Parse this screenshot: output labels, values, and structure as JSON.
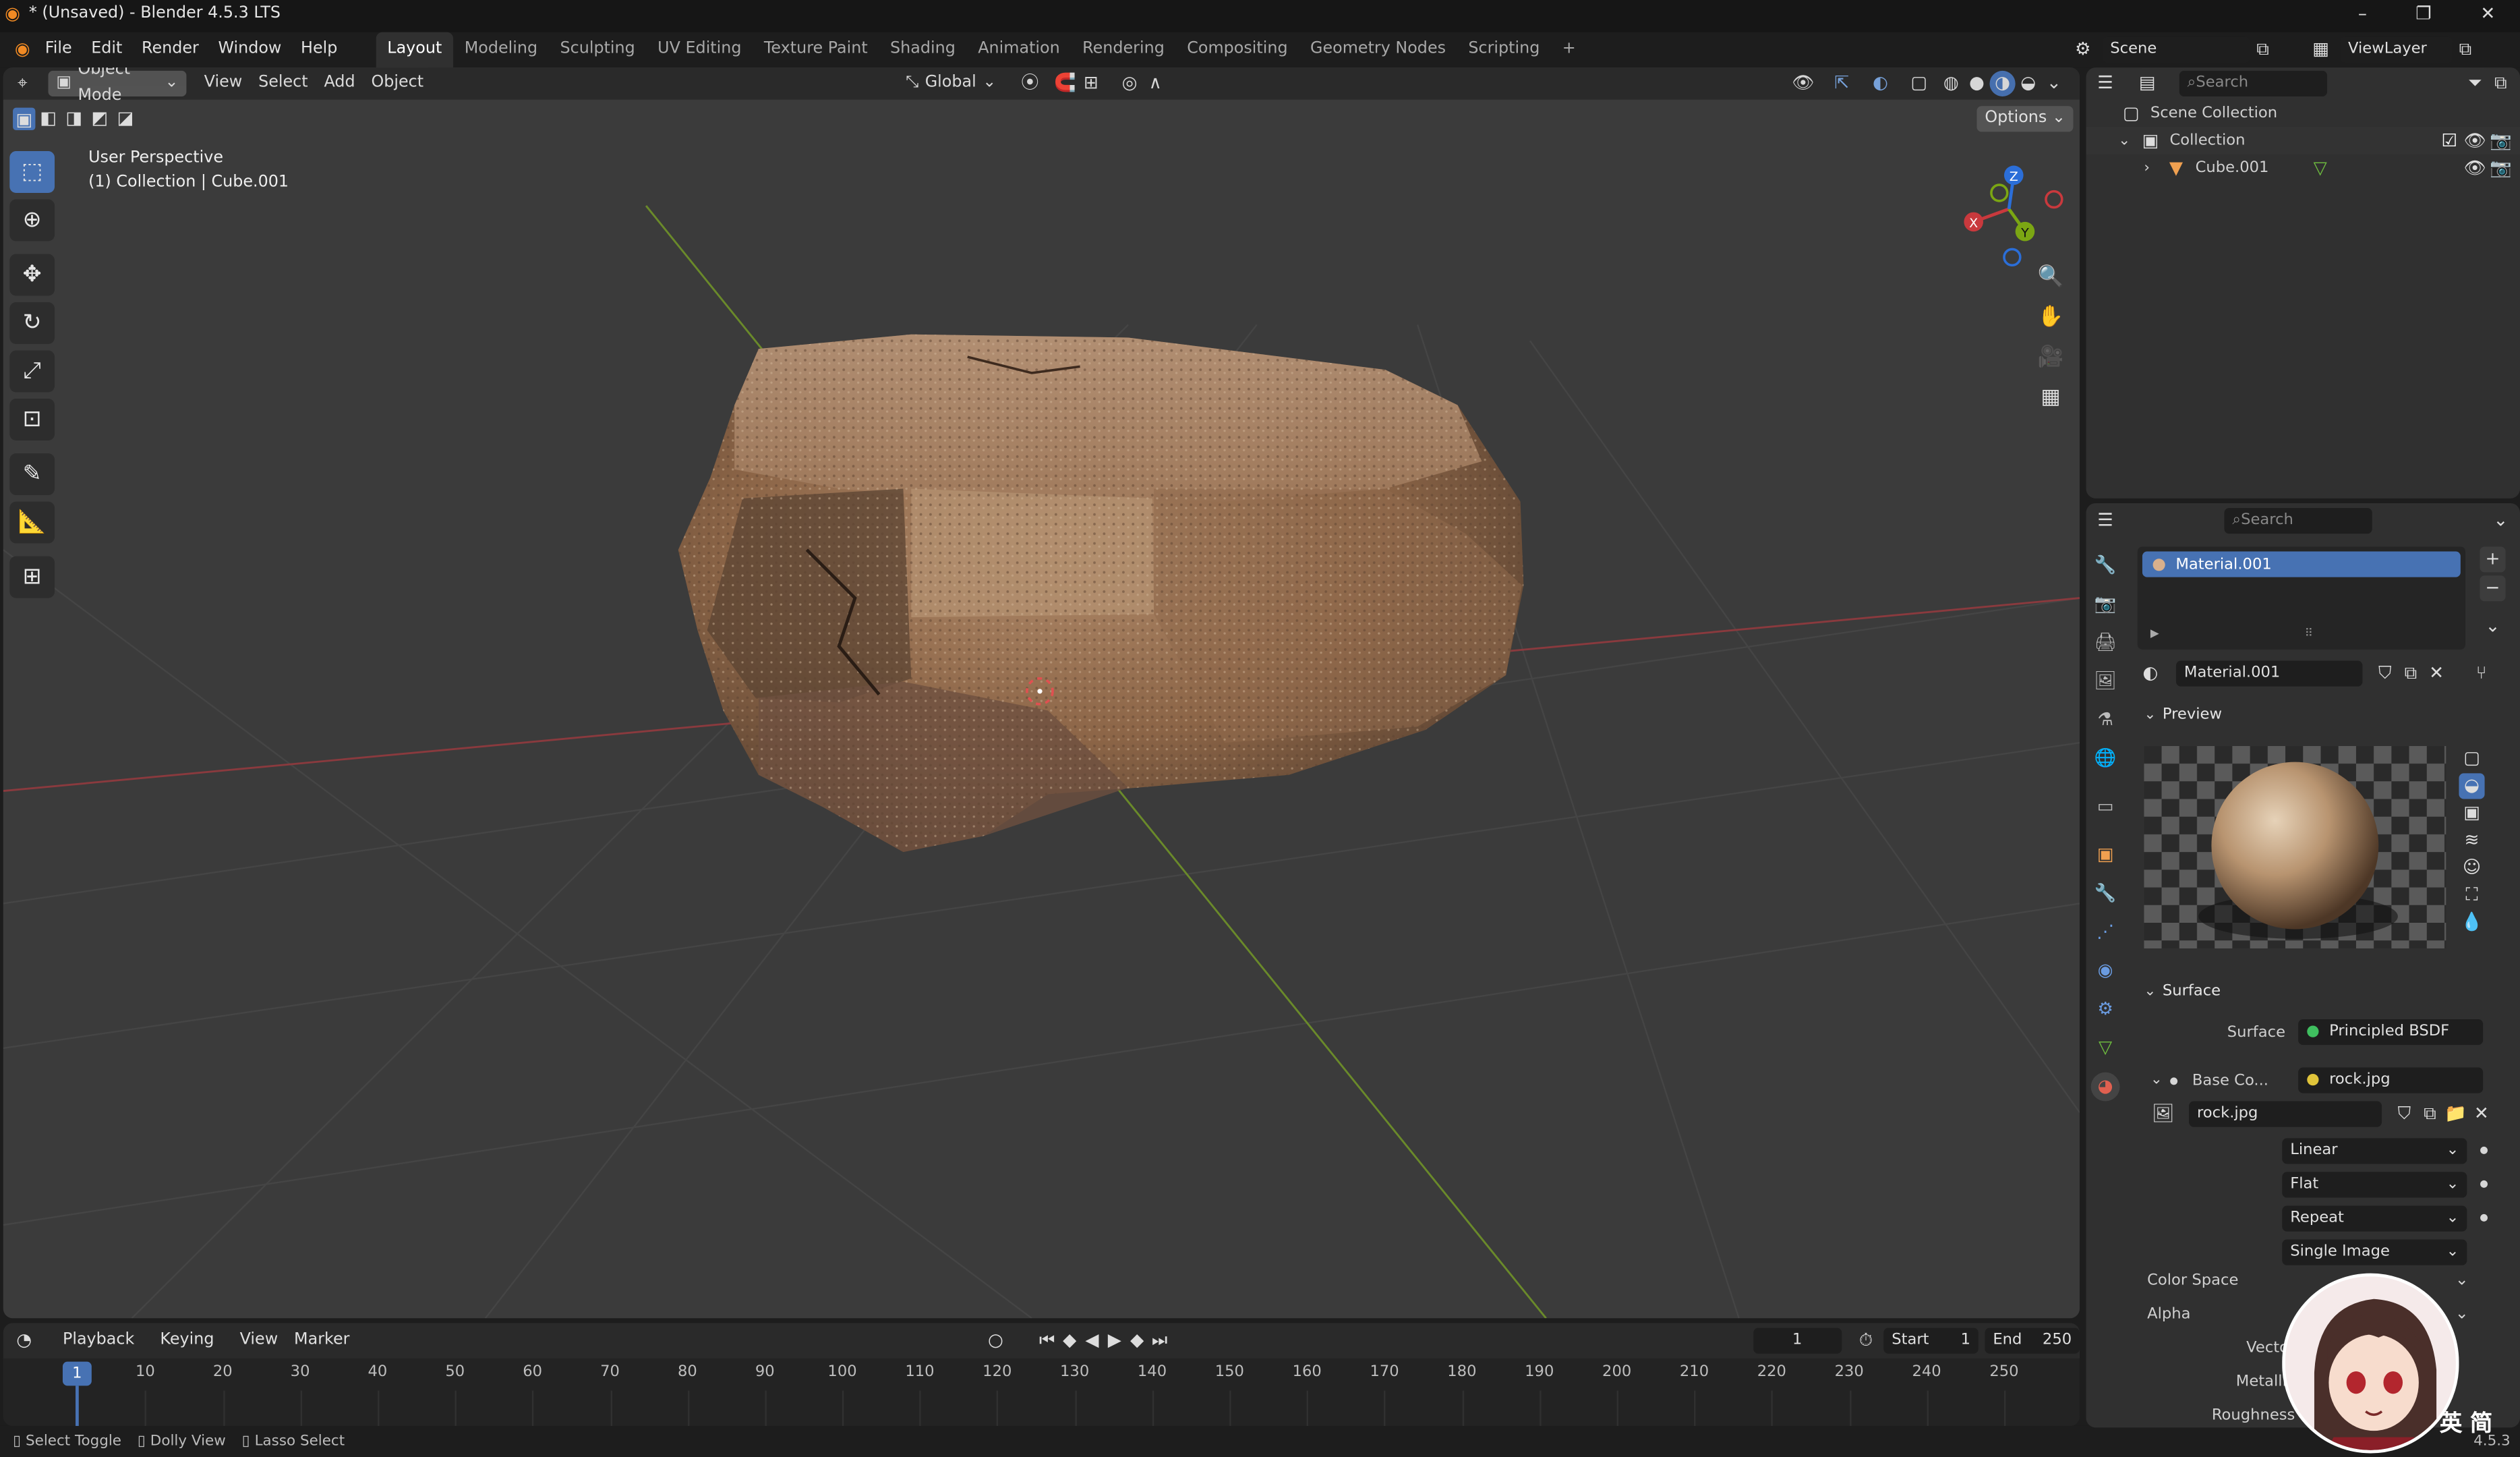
{
  "window": {
    "title": "* (Unsaved) - Blender 4.5.3 LTS",
    "minimize": "–",
    "maximize": "❐",
    "close": "✕"
  },
  "menus": [
    "File",
    "Edit",
    "Render",
    "Window",
    "Help"
  ],
  "workspaces": [
    "Layout",
    "Modeling",
    "Sculpting",
    "UV Editing",
    "Texture Paint",
    "Shading",
    "Animation",
    "Rendering",
    "Compositing",
    "Geometry Nodes",
    "Scripting"
  ],
  "workspace_add": "+",
  "scene": {
    "name": "Scene",
    "view_layer": "ViewLayer"
  },
  "viewport": {
    "mode": "Object Mode",
    "menus": [
      "View",
      "Select",
      "Add",
      "Object"
    ],
    "orientation": "Global",
    "options_label": "Options",
    "overlay_line1": "User Perspective",
    "overlay_line2": "(1) Collection | Cube.001",
    "gizmo_axes": {
      "x": "X",
      "y": "Y",
      "z": "Z"
    }
  },
  "outliner": {
    "search_placeholder": "Search",
    "scene_collection": "Scene Collection",
    "collection": "Collection",
    "object": "Cube.001"
  },
  "properties": {
    "search_placeholder": "Search",
    "material_slot": "Material.001",
    "material_name": "Material.001",
    "preview_label": "Preview",
    "surface_section": "Surface",
    "surface_label": "Surface",
    "surface_value": "Principled BSDF",
    "base_color_label": "Base Co...",
    "base_color_value": "rock.jpg",
    "image_name": "rock.jpg",
    "interpolation": "Linear",
    "projection": "Flat",
    "extension": "Repeat",
    "source": "Single Image",
    "color_space_label": "Color Space",
    "alpha_label": "Alpha",
    "vector_label": "Vector",
    "metallic_label": "Metallic",
    "roughness_label": "Roughness"
  },
  "timeline": {
    "menus": [
      "Playback",
      "Keying",
      "View",
      "Marker"
    ],
    "current_frame": "1",
    "start_label": "Start",
    "start_value": "1",
    "end_label": "End",
    "end_value": "250",
    "ruler_ticks": [
      "10",
      "20",
      "30",
      "40",
      "50",
      "60",
      "70",
      "80",
      "90",
      "100",
      "110",
      "120",
      "130",
      "140",
      "150",
      "160",
      "170",
      "180",
      "190",
      "200",
      "210",
      "220",
      "230",
      "240",
      "250"
    ],
    "playhead_label": "1"
  },
  "statusbar": {
    "item1": "Select Toggle",
    "item2": "Dolly View",
    "item3": "Lasso Select",
    "version": "4.5.3"
  },
  "overlay_badge": "英 简",
  "colors": {
    "accent": "#4772b3",
    "x_axis": "#c9393d",
    "y_axis": "#7ba613",
    "z_axis": "#2b6ed8",
    "viewport_bg": "#3b3b3b"
  }
}
